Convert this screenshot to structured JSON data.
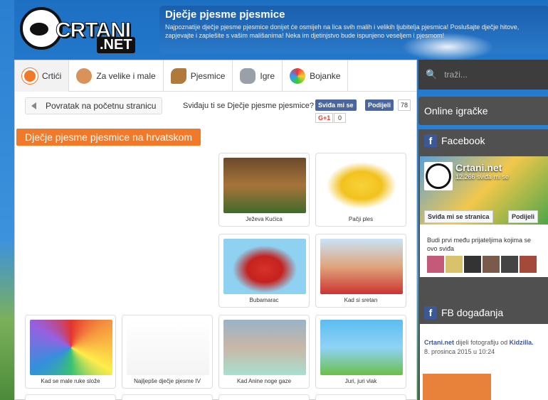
{
  "header": {
    "logo_text": "CRTANI",
    "logo_net": ".NET",
    "title": "Dječje pjesme pjesmice",
    "description": "Najpoznatije dječje pjesme pjesmice donijet će osmijeh na lica svih malih i velikih ljubitelja pjesmica! Poslušajte dječje hitove, zapjevajte i zaplešite s vašim mališanima! Neka im djetinjstvo bude ispunjeno veseljem i pjesmom!"
  },
  "nav": {
    "items": [
      {
        "label": "Crtići",
        "icon": "crtani-logo-icon"
      },
      {
        "label": "Za velike i male",
        "icon": "kids-icon"
      },
      {
        "label": "Pjesmice",
        "icon": "guitar-icon"
      },
      {
        "label": "Igre",
        "icon": "gamepad-icon"
      },
      {
        "label": "Bojanke",
        "icon": "palette-icon"
      }
    ]
  },
  "toolbar": {
    "back_label": "Povratak na početnu stranicu",
    "like_question": "Sviđaju ti se Dječje pjesme pjesmice?",
    "fb_like": "Sviđa mi se",
    "fb_share": "Podijeli",
    "fb_count": "78",
    "gplus_label": "G+1",
    "gplus_count": "0"
  },
  "section": {
    "title": "Dječje pjesme pjesmice na hrvatskom"
  },
  "cards": [
    {
      "label": "Ježeva Kućica"
    },
    {
      "label": "Pačji ples"
    },
    {
      "label": "Bubamarac"
    },
    {
      "label": "Kad si sretan"
    },
    {
      "label": "Kad se male ruke slože"
    },
    {
      "label": "Najljepše dječje pjesme IV"
    },
    {
      "label": "Kad Anine noge gaze"
    },
    {
      "label": "Juri, juri vlak"
    }
  ],
  "sidebar": {
    "search_placeholder": "traži...",
    "online_title": "Online igračke",
    "facebook_title": "Facebook",
    "fb_page_name": "Crtani.net",
    "fb_page_likes": "12.266 sviđa mi se",
    "fb_like_page": "Sviđa mi se stranica",
    "fb_share_page": "Podijeli",
    "fb_friends_text": "Budi prvi među prijateljima kojima se ovo sviđa",
    "events_title": "FB događanja",
    "event_author": "Crtani.net",
    "event_action": "dijeli",
    "event_object": "fotografiju",
    "event_from": "od",
    "event_source": "Kidzilla.",
    "event_date": "8. prosinca 2015 u 10:24"
  },
  "colors": {
    "accent_orange": "#f07a2a",
    "fb_blue": "#3b5998",
    "sidebar_dark": "#505050"
  }
}
